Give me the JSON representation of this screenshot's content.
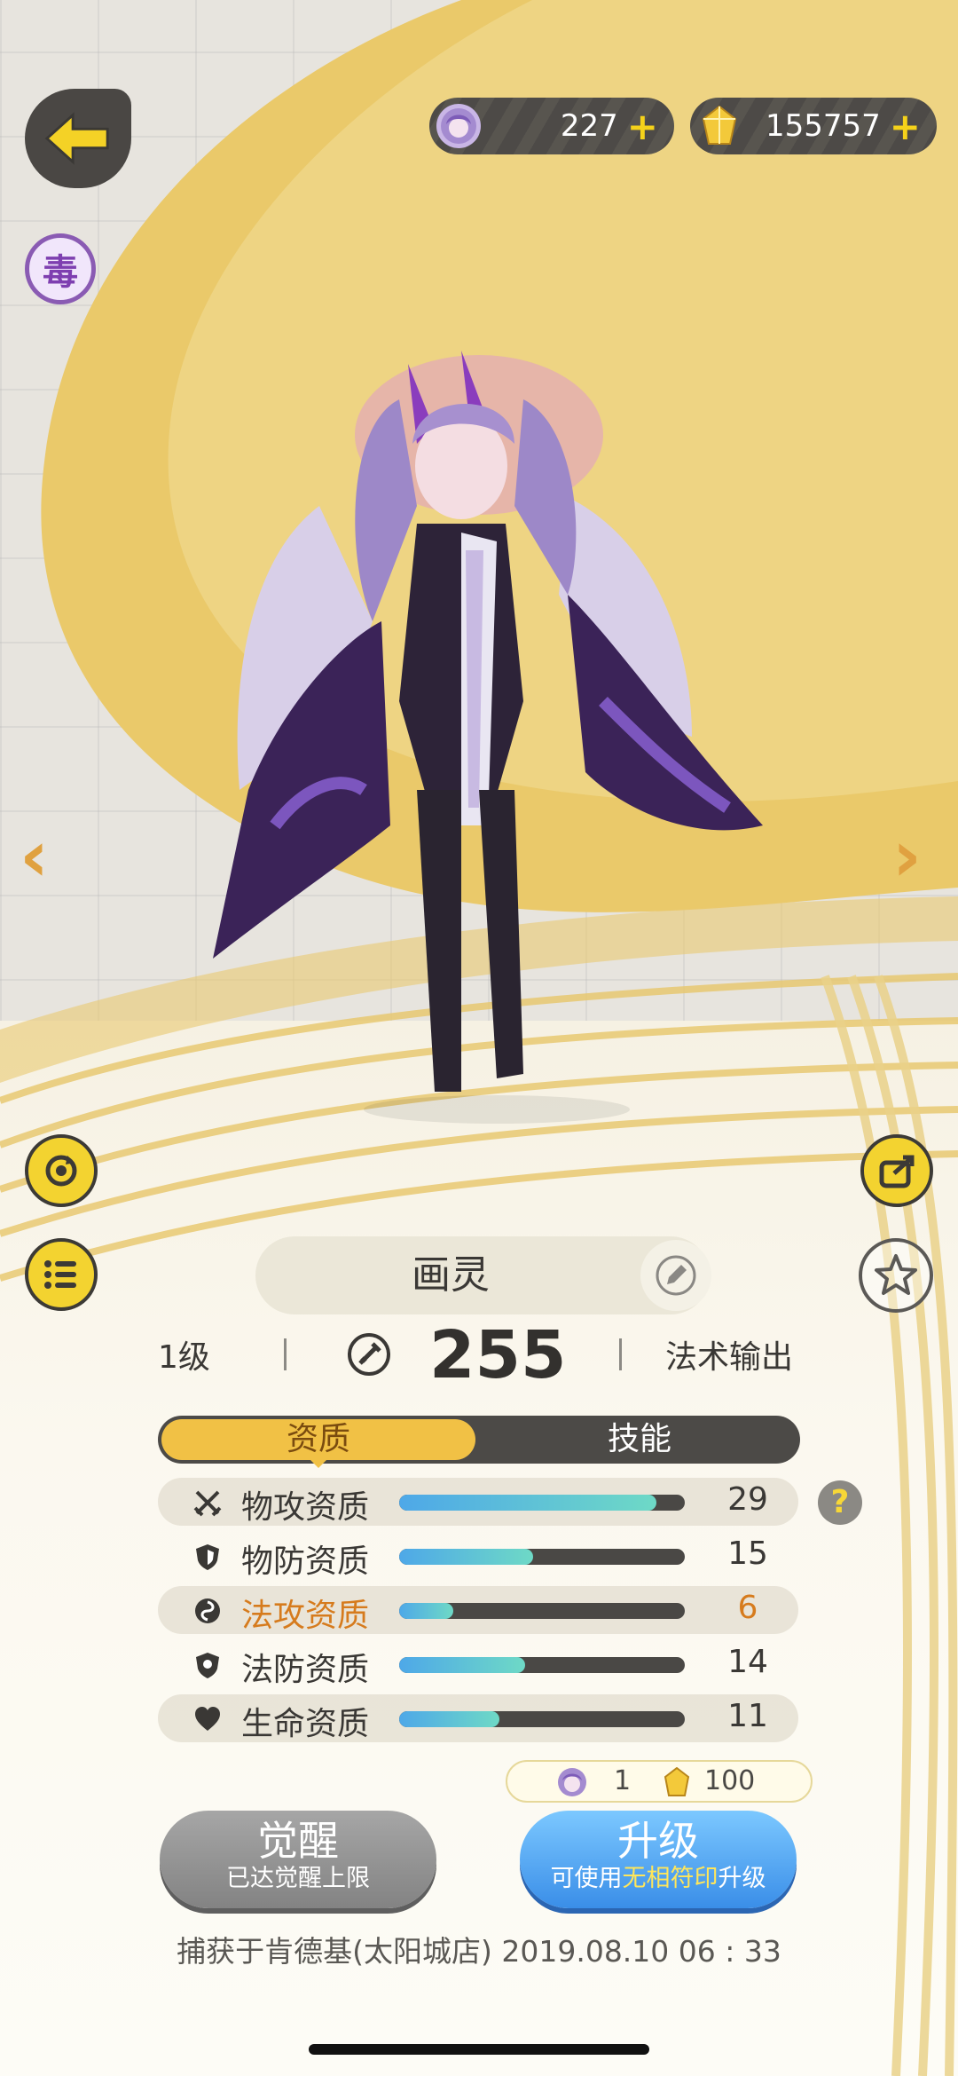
{
  "currency": {
    "spirit_count": "227",
    "gold_count": "155757",
    "plus_symbol": "+"
  },
  "element_badge": "毒",
  "character": {
    "name": "画灵",
    "level": "1级",
    "power": "255",
    "role": "法术输出"
  },
  "tabs": {
    "active": "资质",
    "inactive": "技能"
  },
  "attributes": [
    {
      "name": "物攻资质",
      "value": "29",
      "fill": 0.9,
      "icon": "crossed-swords-icon",
      "highlight": false
    },
    {
      "name": "物防资质",
      "value": "15",
      "fill": 0.47,
      "icon": "shield-icon",
      "highlight": false
    },
    {
      "name": "法攻资质",
      "value": "6",
      "fill": 0.19,
      "icon": "magic-swirl-icon",
      "highlight": true
    },
    {
      "name": "法防资质",
      "value": "14",
      "fill": 0.44,
      "icon": "magic-shield-icon",
      "highlight": false
    },
    {
      "name": "生命资质",
      "value": "11",
      "fill": 0.35,
      "icon": "heart-icon",
      "highlight": false
    }
  ],
  "help_label": "?",
  "upgrade_cost": {
    "spirit": "1",
    "gold": "100"
  },
  "buttons": {
    "awaken_label": "觉醒",
    "awaken_sub": "已达觉醒上限",
    "upgrade_label": "升级",
    "upgrade_sub_pre": "可使用",
    "upgrade_sub_hl": "无相符印",
    "upgrade_sub_post": "升级"
  },
  "capture_info": "捕获于肯德基(太阳城店)  2019.08.10   06 : 33",
  "colors": {
    "accent_gold": "#f1c145",
    "highlight_orange": "#d67b1d",
    "upgrade_blue": "#3a8ee8"
  }
}
